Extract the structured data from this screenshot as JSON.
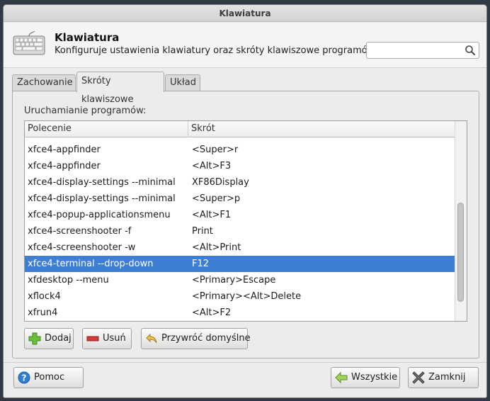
{
  "window": {
    "title": "Klawiatura"
  },
  "header": {
    "title": "Klawiatura",
    "subtitle": "Konfiguruje ustawienia klawiatury oraz skróty klawiszowe programów",
    "search_value": ""
  },
  "tabs": [
    {
      "label": "Zachowanie",
      "active": false
    },
    {
      "label": "Skróty klawiszowe",
      "active": true
    },
    {
      "label": "Układ",
      "active": false
    }
  ],
  "panel": {
    "section_label": "Uruchamianie programów:"
  },
  "table": {
    "columns": [
      "Polecenie",
      "Skrót"
    ],
    "rows": [
      {
        "command": "xfce4-appfinder",
        "shortcut": "<Super>r"
      },
      {
        "command": "xfce4-appfinder",
        "shortcut": "<Alt>F3"
      },
      {
        "command": "xfce4-display-settings --minimal",
        "shortcut": "XF86Display"
      },
      {
        "command": "xfce4-display-settings --minimal",
        "shortcut": "<Super>p"
      },
      {
        "command": "xfce4-popup-applicationsmenu",
        "shortcut": "<Alt>F1"
      },
      {
        "command": "xfce4-screenshooter -f",
        "shortcut": "Print"
      },
      {
        "command": "xfce4-screenshooter -w",
        "shortcut": "<Alt>Print"
      },
      {
        "command": "xfce4-terminal --drop-down",
        "shortcut": "F12"
      },
      {
        "command": "xfdesktop --menu",
        "shortcut": "<Primary>Escape"
      },
      {
        "command": "xflock4",
        "shortcut": "<Primary><Alt>Delete"
      },
      {
        "command": "xfrun4",
        "shortcut": "<Alt>F2"
      }
    ],
    "selected_index": 7
  },
  "actions": {
    "add_label": "Dodaj",
    "remove_label": "Usuń",
    "restore_label": "Przywróć domyślne"
  },
  "footer": {
    "help_label": "Pomoc",
    "all_label": "Wszystkie",
    "close_label": "Zamknij"
  },
  "colors": {
    "selection": "#3d7fd4",
    "add_icon": "#6cbf3b",
    "remove_icon": "#d23a3a",
    "help_icon": "#2e7fd1"
  }
}
